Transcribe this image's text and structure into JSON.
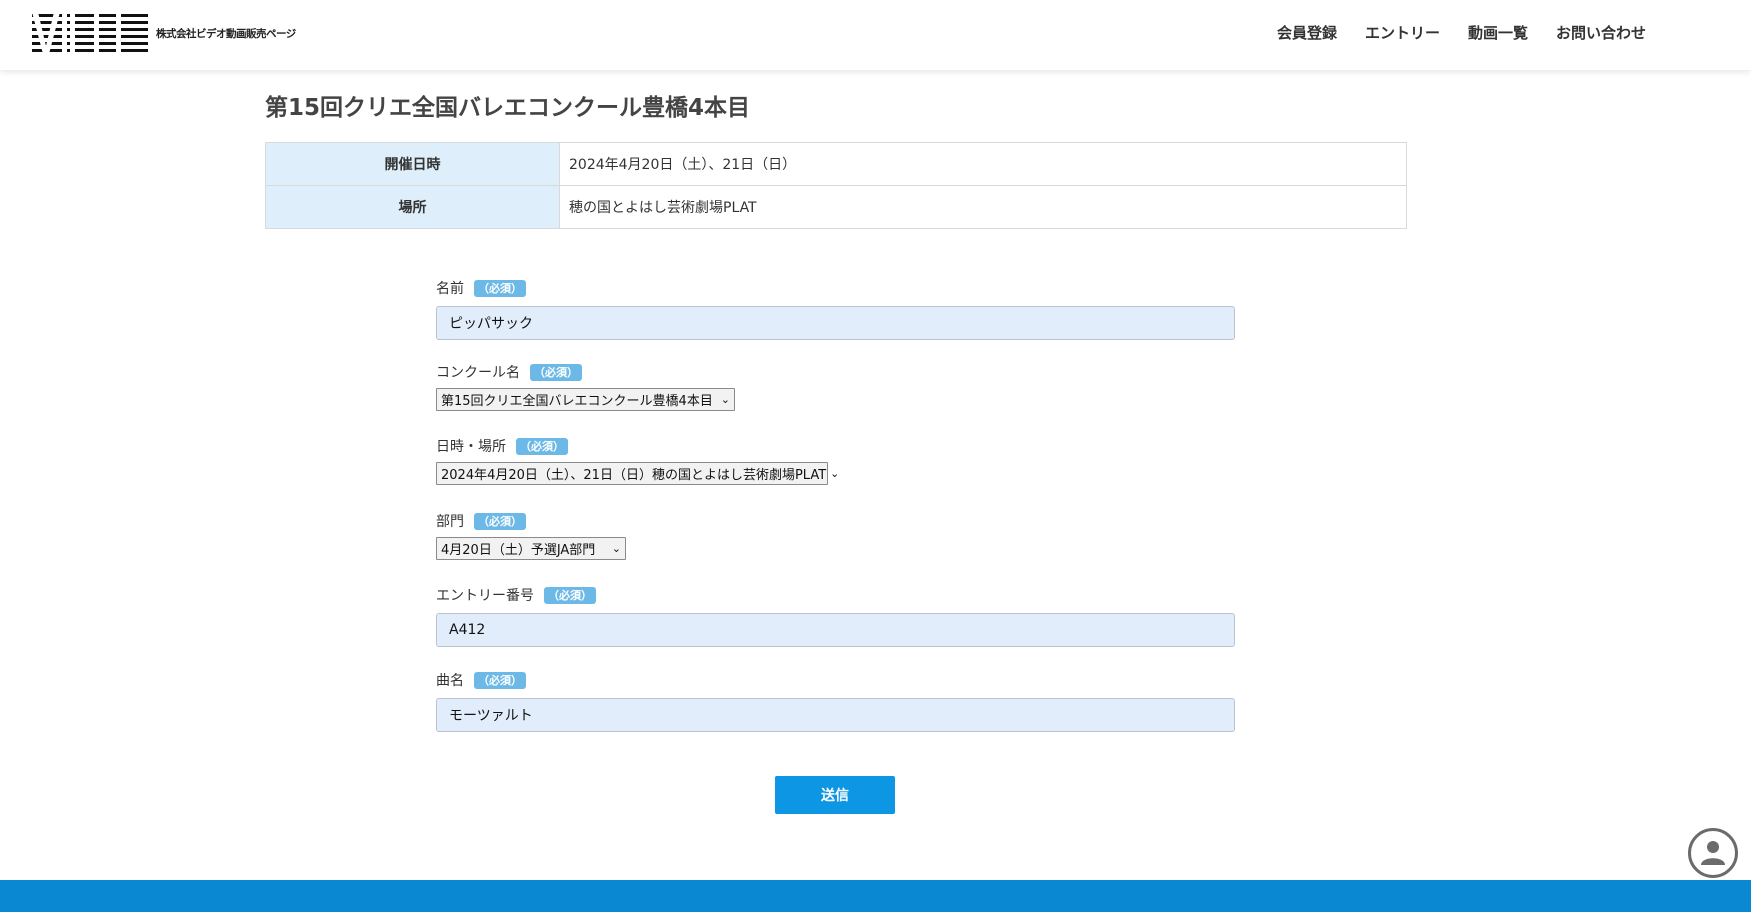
{
  "header": {
    "logo_text": "株式会社ビデオ動画販売ページ",
    "nav": [
      "会員登録",
      "エントリー",
      "動画一覧",
      "お問い合わせ"
    ]
  },
  "page_title": "第15回クリエ全国バレエコンクール豊橋4本目",
  "info_table": [
    {
      "label": "開催日時",
      "value": "2024年4月20日（土）、21日（日）"
    },
    {
      "label": "場所",
      "value": "穂の国とよはし芸術劇場PLAT"
    }
  ],
  "required_badge": "（必須）",
  "form": {
    "name": {
      "label": "名前",
      "value": "ピッパサック"
    },
    "contest": {
      "label": "コンクール名",
      "value": "第15回クリエ全国バレエコンクール豊橋4本目"
    },
    "datetime": {
      "label": "日時・場所",
      "value": "2024年4月20日（土）、21日（日）穂の国とよはし芸術劇場PLAT"
    },
    "division": {
      "label": "部門",
      "value": "4月20日（土）予選JA部門"
    },
    "entry_no": {
      "label": "エントリー番号",
      "value": "A412"
    },
    "song": {
      "label": "曲名",
      "value": "モーツァルト"
    }
  },
  "submit_label": "送信",
  "colors": {
    "accent": "#0d96e3",
    "badge": "#6cb8e6",
    "table_header": "#deeefa",
    "input_bg": "#e2edfb",
    "footer": "#0a88d2"
  },
  "icons": {
    "chevron": "chevron-down-icon",
    "account": "account-icon"
  }
}
